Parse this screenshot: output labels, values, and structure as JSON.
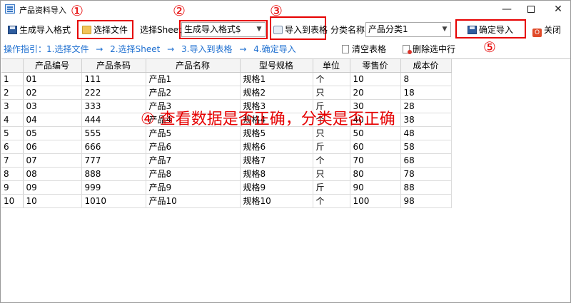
{
  "window": {
    "title": "产品资料导入",
    "min_glyph": "—",
    "close_glyph": "✕"
  },
  "toolbar": {
    "gen_template_label": "生成导入格式",
    "choose_file_label": "选择文件",
    "sheet_label": "选择Sheet",
    "sheet_value": "生成导入格式$",
    "import_table_label": "导入到表格",
    "category_label": "分类名称",
    "category_value": "产品分类1",
    "confirm_import_label": "确定导入",
    "close_label": "关闭",
    "close_icon_text": "O"
  },
  "guide": {
    "steps": [
      "操作指引：1.选择文件",
      "→",
      "2.选择Sheet",
      "→",
      "3.导入到表格",
      "→",
      "4.确定导入"
    ],
    "clear_label": "清空表格",
    "delete_label": "删除选中行"
  },
  "annotations": {
    "step1": "①",
    "step2": "②",
    "step3": "③",
    "step5": "⑤",
    "step4_note": "④ 查看数据是否正确，分类是否正确",
    "accent": "#e60000"
  },
  "grid": {
    "headers": [
      "产品编号",
      "产品条码",
      "产品名称",
      "型号规格",
      "单位",
      "零售价",
      "成本价"
    ],
    "rows": [
      [
        "1",
        "01",
        "111",
        "产品1",
        "规格1",
        "个",
        "10",
        "8"
      ],
      [
        "2",
        "02",
        "222",
        "产品2",
        "规格2",
        "只",
        "20",
        "18"
      ],
      [
        "3",
        "03",
        "333",
        "产品3",
        "规格3",
        "斤",
        "30",
        "28"
      ],
      [
        "4",
        "04",
        "444",
        "产品4",
        "规格4",
        "个",
        "40",
        "38"
      ],
      [
        "5",
        "05",
        "555",
        "产品5",
        "规格5",
        "只",
        "50",
        "48"
      ],
      [
        "6",
        "06",
        "666",
        "产品6",
        "规格6",
        "斤",
        "60",
        "58"
      ],
      [
        "7",
        "07",
        "777",
        "产品7",
        "规格7",
        "个",
        "70",
        "68"
      ],
      [
        "8",
        "08",
        "888",
        "产品8",
        "规格8",
        "只",
        "80",
        "78"
      ],
      [
        "9",
        "09",
        "999",
        "产品9",
        "规格9",
        "斤",
        "90",
        "88"
      ],
      [
        "10",
        "10",
        "1010",
        "产品10",
        "规格10",
        "个",
        "100",
        "98"
      ]
    ]
  },
  "colors": {
    "guide_text": "#1e6fd0",
    "highlight_box": "#e60000"
  }
}
